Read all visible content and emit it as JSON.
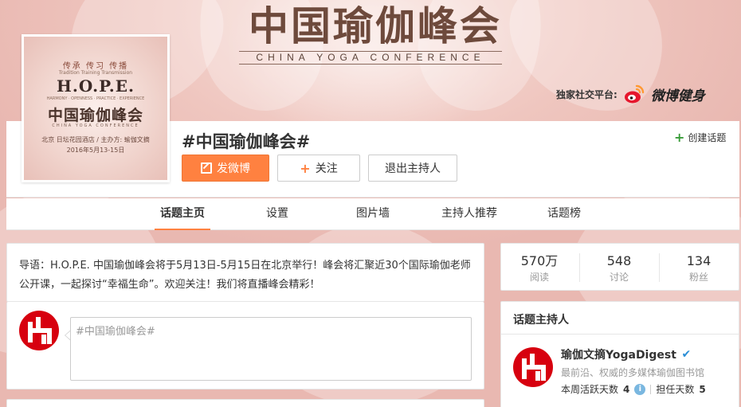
{
  "banner": {
    "title": "中国瑜伽峰会",
    "subtitle": "CHINA YOGA CONFERENCE",
    "partner_label": "独家社交平台:",
    "partner_brand": "微博健身"
  },
  "cover": {
    "top_line": "传承 传习 传播",
    "top_en": "Tradition Training Transmission",
    "hope": "H.O.P.E.",
    "tiny": "HARMONY · OPENNESS · PRACTICE · EXPERIENCE",
    "title": "中国瑜伽峰会",
    "title_en": "CHINA YOGA CONFERENCE",
    "info": "北京 日坛花园酒店 / 主办方: 瑜伽文摘",
    "date": "2016年5月13-15日"
  },
  "profile": {
    "topic_title": "#中国瑜伽峰会#",
    "create_topic": "创建话题",
    "post_button": "发微博",
    "follow_button": "关注",
    "exit_host_button": "退出主持人"
  },
  "nav": {
    "items": [
      {
        "label": "话题主页"
      },
      {
        "label": "设置"
      },
      {
        "label": "图片墙"
      },
      {
        "label": "主持人推荐"
      },
      {
        "label": "话题榜"
      }
    ]
  },
  "main": {
    "intro": "导语：H.O.P.E. 中国瑜伽峰会将于5月13日-5月15日在北京举行！峰会将汇聚近30个国际瑜伽老师公开课，一起探讨“幸福生命”。欢迎关注！我们将直播峰会精彩！",
    "compose_placeholder": "#中国瑜伽峰会#"
  },
  "stats": [
    {
      "value": "570万",
      "label": "阅读"
    },
    {
      "value": "548",
      "label": "讨论"
    },
    {
      "value": "134",
      "label": "粉丝"
    }
  ],
  "host": {
    "section_title": "话题主持人",
    "name": "瑜伽文摘YogaDigest",
    "desc": "最前沿、权威的多媒体瑜伽图书馆",
    "active_label": "本周活跃天数",
    "active_value": "4",
    "host_label": "担任天数",
    "host_value": "5"
  },
  "colors": {
    "accent": "#ff8140",
    "brand_red": "#d7000f",
    "verify_blue": "#2a8ed6"
  }
}
